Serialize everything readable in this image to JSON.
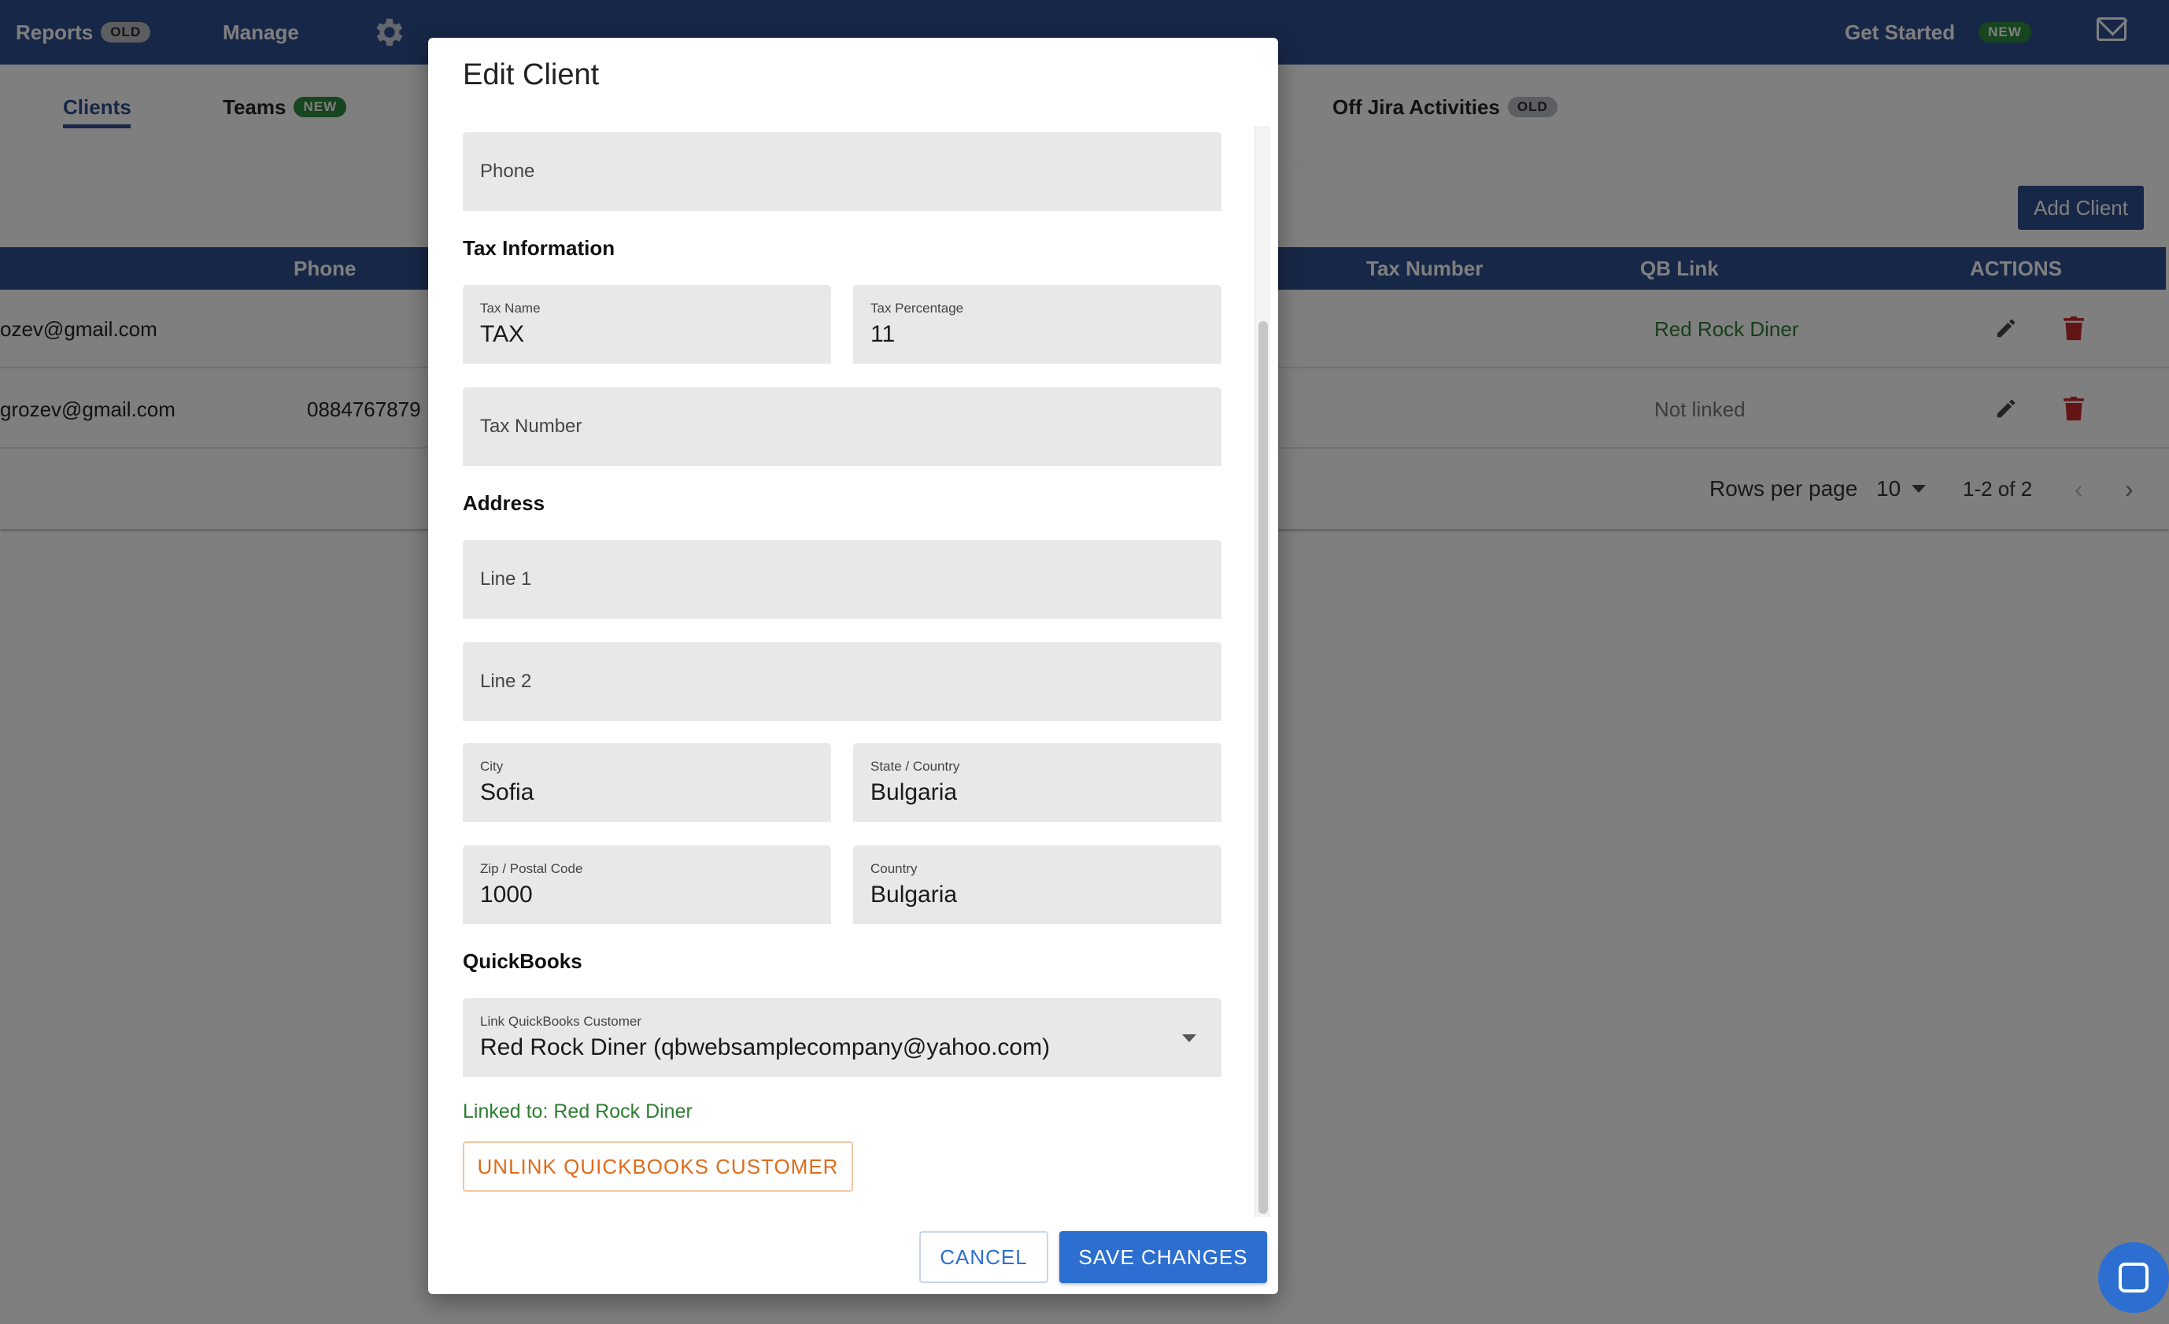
{
  "topbar": {
    "reports_label": "Reports",
    "reports_badge": "OLD",
    "manage_label": "Manage",
    "get_started_label": "Get Started",
    "get_started_badge": "NEW"
  },
  "tabs": {
    "clients": "Clients",
    "teams": "Teams",
    "teams_badge": "NEW",
    "off_jira": "Off Jira Activities",
    "off_jira_badge": "OLD"
  },
  "table": {
    "add_client_label": "Add Client",
    "headers": {
      "phone": "Phone",
      "tax_number": "Tax Number",
      "qb_link": "QB Link",
      "actions": "ACTIONS"
    },
    "rows": [
      {
        "email": "ozev@gmail.com",
        "phone": "",
        "qb_link": "Red Rock Diner"
      },
      {
        "email": "grozev@gmail.com",
        "phone": "0884767879",
        "qb_link": "Not linked"
      }
    ],
    "footer": {
      "rows_per_page_label": "Rows per page",
      "rows_per_page_value": "10",
      "range": "1-2 of 2"
    }
  },
  "dialog": {
    "title": "Edit Client",
    "phone": {
      "placeholder": "Phone"
    },
    "tax_section": "Tax Information",
    "tax_name": {
      "label": "Tax Name",
      "value": "TAX"
    },
    "tax_percentage": {
      "label": "Tax Percentage",
      "value": "11"
    },
    "tax_number": {
      "placeholder": "Tax Number"
    },
    "address_section": "Address",
    "line1": {
      "placeholder": "Line 1"
    },
    "line2": {
      "placeholder": "Line 2"
    },
    "city": {
      "label": "City",
      "value": "Sofia"
    },
    "state": {
      "label": "State / Country",
      "value": "Bulgaria"
    },
    "zip": {
      "label": "Zip / Postal Code",
      "value": "1000"
    },
    "country": {
      "label": "Country",
      "value": "Bulgaria"
    },
    "qb_section": "QuickBooks",
    "qb_customer": {
      "label": "Link QuickBooks Customer",
      "value": "Red Rock Diner (qbwebsamplecompany@yahoo.com)"
    },
    "linked_text": "Linked to: Red Rock Diner",
    "unlink_label": "UNLINK QUICKBOOKS CUSTOMER",
    "cancel_label": "CANCEL",
    "save_label": "SAVE CHANGES"
  },
  "colors": {
    "primary": "#2f4f8f",
    "button_blue": "#2d6fd1",
    "link_green": "#2e7d32",
    "delete_red": "#c62828",
    "unlink_orange": "#e06c1a"
  },
  "icons": [
    "gear-icon",
    "mail-icon",
    "pencil-icon",
    "trash-icon",
    "chevron-left-icon",
    "chevron-right-icon",
    "dropdown-arrow-icon",
    "chat-icon"
  ]
}
